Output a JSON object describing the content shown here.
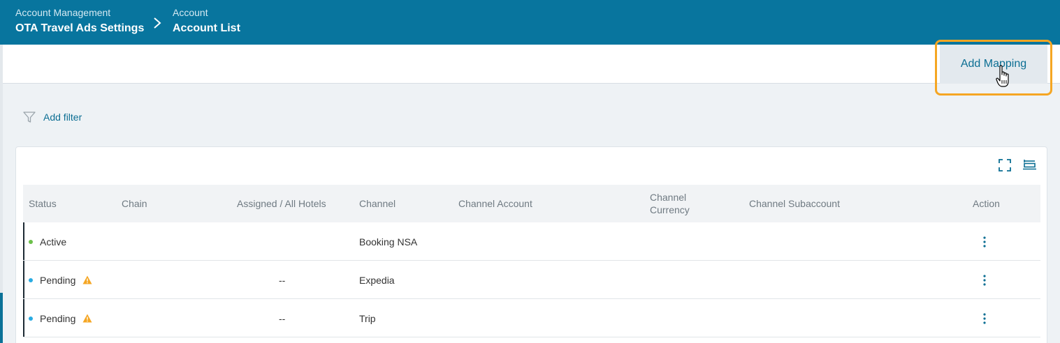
{
  "header": {
    "breadcrumb": [
      {
        "section": "Account Management",
        "title": "OTA Travel Ads Settings"
      },
      {
        "section": "Account",
        "title": "Account List"
      }
    ]
  },
  "toolbar": {
    "add_mapping_label": "Add Mapping"
  },
  "filter": {
    "add_filter_label": "Add filter",
    "icon": "filter-icon"
  },
  "table": {
    "columns": [
      "Status",
      "Chain",
      "Assigned / All Hotels",
      "Channel",
      "Channel Account",
      "Channel Currency",
      "Channel Subaccount",
      "Action"
    ],
    "rows": [
      {
        "status": "Active",
        "status_color": "#6cc04a",
        "warning": false,
        "chain": "",
        "assigned": "",
        "channel": "Booking NSA",
        "channel_account": "",
        "currency": "",
        "subaccount": ""
      },
      {
        "status": "Pending",
        "status_color": "#29abe2",
        "warning": true,
        "chain": "",
        "assigned": "--",
        "channel": "Expedia",
        "channel_account": "",
        "currency": "",
        "subaccount": ""
      },
      {
        "status": "Pending",
        "status_color": "#29abe2",
        "warning": true,
        "chain": "",
        "assigned": "--",
        "channel": "Trip",
        "channel_account": "",
        "currency": "",
        "subaccount": ""
      }
    ]
  },
  "colors": {
    "header_bg": "#08759e",
    "accent": "#0b6e93",
    "highlight": "#f5a623",
    "warning": "#f5a623"
  }
}
